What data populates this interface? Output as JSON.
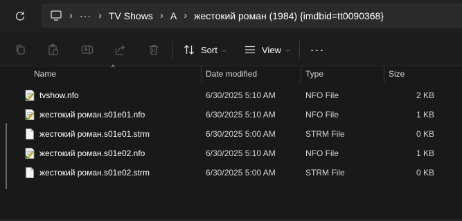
{
  "addressbar": {
    "breadcrumbs": [
      "TV Shows",
      "A",
      "жестокий роман (1984) {imdbid=tt0090368}"
    ],
    "overflow": "···"
  },
  "toolbar": {
    "sort_label": "Sort",
    "view_label": "View",
    "more_label": "···",
    "icons": [
      "copy-icon",
      "paste-icon",
      "rename-icon",
      "share-icon",
      "delete-icon"
    ]
  },
  "columns": {
    "name": "Name",
    "date": "Date modified",
    "type": "Type",
    "size": "Size"
  },
  "files": [
    {
      "name": "tvshow.nfo",
      "date": "6/30/2025 5:10 AM",
      "type": "NFO File",
      "size": "2 KB",
      "icon": "nfo-file-icon"
    },
    {
      "name": "жестокий роман.s01e01.nfo",
      "date": "6/30/2025 5:10 AM",
      "type": "NFO File",
      "size": "1 KB",
      "icon": "nfo-file-icon"
    },
    {
      "name": "жестокий роман.s01e01.strm",
      "date": "6/30/2025 5:00 AM",
      "type": "STRM File",
      "size": "0 KB",
      "icon": "blank-file-icon"
    },
    {
      "name": "жестокий роман.s01e02.nfo",
      "date": "6/30/2025 5:10 AM",
      "type": "NFO File",
      "size": "1 KB",
      "icon": "nfo-file-icon"
    },
    {
      "name": "жестокий роман.s01e02.strm",
      "date": "6/30/2025 5:00 AM",
      "type": "STRM File",
      "size": "0 KB",
      "icon": "blank-file-icon"
    }
  ]
}
